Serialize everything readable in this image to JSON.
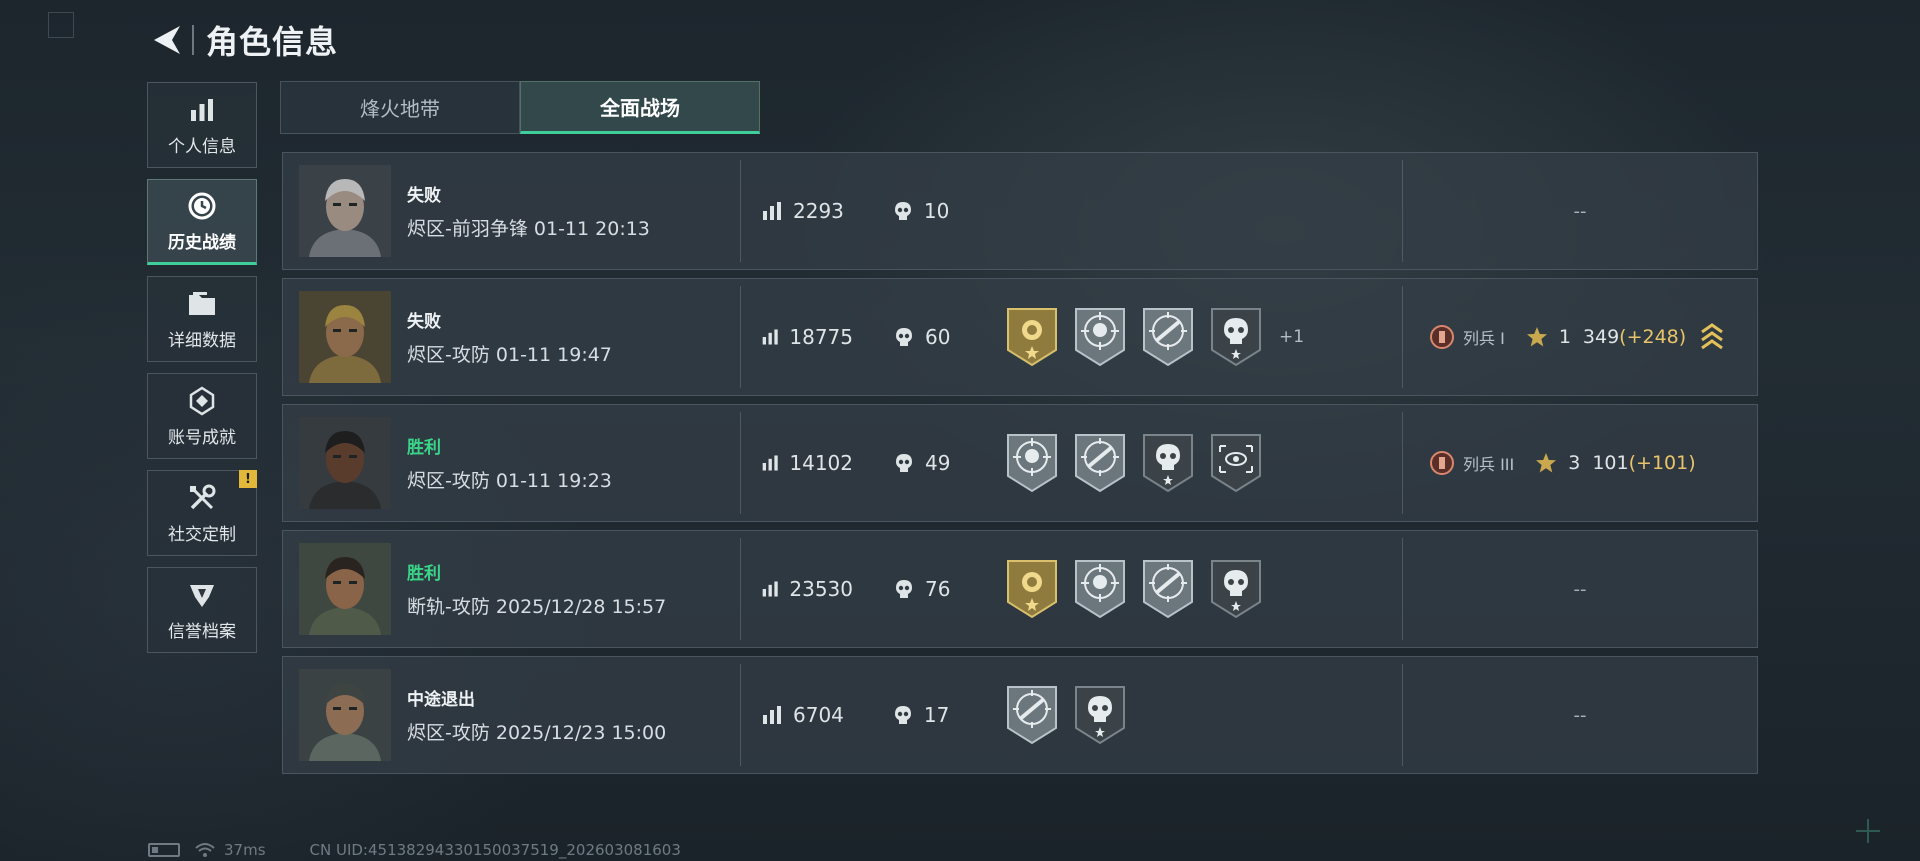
{
  "header": {
    "title": "角色信息"
  },
  "sidebar": {
    "items": [
      {
        "label": "个人信息",
        "icon": "bar-chart-icon",
        "active": false
      },
      {
        "label": "历史战绩",
        "icon": "clock-icon",
        "active": true
      },
      {
        "label": "详细数据",
        "icon": "folder-icon",
        "active": false
      },
      {
        "label": "账号成就",
        "icon": "achievement-icon",
        "active": false
      },
      {
        "label": "社交定制",
        "icon": "tools-icon",
        "active": false,
        "badge": "!"
      },
      {
        "label": "信誉档案",
        "icon": "credit-shield-icon",
        "active": false
      }
    ]
  },
  "tabs": [
    {
      "label": "烽火地带",
      "active": false
    },
    {
      "label": "全面战场",
      "active": true
    }
  ],
  "matches": [
    {
      "result": "失败",
      "win": false,
      "mode_time": "烬区-前羽争锋 01-11 20:13",
      "score": "2293",
      "kills": "10",
      "medals": [],
      "more": "",
      "rank": null,
      "rank_placeholder": "--"
    },
    {
      "result": "失败",
      "win": false,
      "mode_time": "烬区-攻防 01-11 19:47",
      "score": "18775",
      "kills": "60",
      "medals": [
        "gold-rose-medal",
        "skull-crosshair-medal",
        "rifle-crosshair-medal",
        "dark-skull-medal"
      ],
      "more": "+1",
      "rank": {
        "badge": "I",
        "name": "列兵 I",
        "stars": "1",
        "points": "349",
        "delta": "(+248)"
      },
      "rank_placeholder": ""
    },
    {
      "result": "胜利",
      "win": true,
      "mode_time": "烬区-攻防 01-11 19:23",
      "score": "14102",
      "kills": "49",
      "medals": [
        "skull-crosshair-medal",
        "rifle-crosshair-medal",
        "dark-skull-medal",
        "eye-target-medal"
      ],
      "more": "",
      "rank": {
        "badge": "III",
        "name": "列兵 III",
        "stars": "3",
        "points": "101",
        "delta": "(+101)"
      },
      "rank_placeholder": ""
    },
    {
      "result": "胜利",
      "win": true,
      "mode_time": "断轨-攻防 2025/12/28 15:57",
      "score": "23530",
      "kills": "76",
      "medals": [
        "gold-rose-medal",
        "skull-crosshair-medal",
        "rifle-crosshair-medal",
        "dark-skull-medal"
      ],
      "more": "",
      "rank": null,
      "rank_placeholder": "--"
    },
    {
      "result": "中途退出",
      "win": false,
      "mode_time": "烬区-攻防 2025/12/23 15:00",
      "score": "6704",
      "kills": "17",
      "medals": [
        "rifle-crosshair-medal",
        "dark-skull-medal"
      ],
      "more": "",
      "rank": null,
      "rank_placeholder": "--"
    }
  ],
  "status_bar": {
    "ping": "37ms",
    "uid": "CN UID:45138294330150037519_202603081603"
  },
  "colors": {
    "accent": "#3fcf9a",
    "win": "#39d68a",
    "gold": "#e8c46a",
    "badge": "#e2b73a"
  }
}
